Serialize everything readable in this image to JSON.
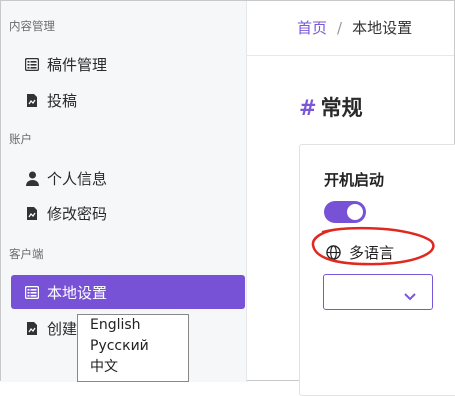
{
  "sidebar": {
    "sections": [
      {
        "title": "内容管理",
        "items": [
          {
            "label": "稿件管理",
            "icon": "list-icon"
          },
          {
            "label": "投稿",
            "icon": "document-icon"
          }
        ]
      },
      {
        "title": "账户",
        "items": [
          {
            "label": "个人信息",
            "icon": "user-icon"
          },
          {
            "label": "修改密码",
            "icon": "document-icon"
          }
        ]
      },
      {
        "title": "客户端",
        "items": [
          {
            "label": "本地设置",
            "icon": "list-icon",
            "active": true
          },
          {
            "label": "创建壁纸",
            "icon": "document-icon"
          }
        ]
      }
    ]
  },
  "breadcrumb": {
    "home": "首页",
    "separator": "/",
    "current": "本地设置"
  },
  "page": {
    "hash": "#",
    "title": "常规"
  },
  "settings": {
    "boot_label": "开机启动",
    "boot_enabled": true,
    "language_label": "多语言",
    "language_icon": "globe-icon",
    "selected_language": "",
    "language_options": [
      "English",
      "Русский",
      "中文"
    ]
  },
  "colors": {
    "accent": "#7852d6",
    "annotation": "#e0281f"
  }
}
